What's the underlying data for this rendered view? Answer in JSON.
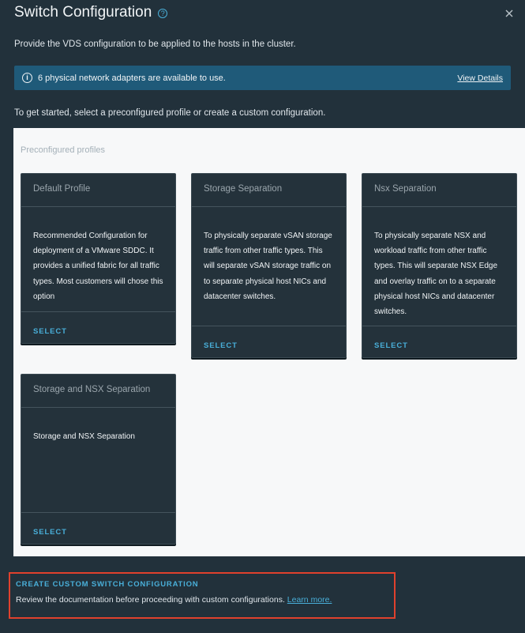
{
  "dialog": {
    "title": "Switch Configuration",
    "help_icon": "help-circle-icon",
    "close_icon": "close-icon",
    "subtitle": "Provide the VDS configuration to be applied to the hosts in the cluster."
  },
  "alert": {
    "icon": "info-circle-icon",
    "message": "6 physical network adapters are available to use.",
    "action_label": "View Details"
  },
  "intro_text": "To get started, select a preconfigured profile or create a custom configuration.",
  "profiles": {
    "section_label": "Preconfigured profiles",
    "cards": [
      {
        "title": "Default Profile",
        "description": "Recommended Configuration for deployment of a VMware SDDC. It provides a unified fabric for all traffic types. Most customers will chose this option",
        "select_label": "SELECT"
      },
      {
        "title": "Storage Separation",
        "description": "To physically separate vSAN storage traffic from other traffic types. This will separate vSAN storage traffic on to separate physical host NICs and datacenter switches.",
        "select_label": "SELECT"
      },
      {
        "title": "Nsx Separation",
        "description": "To physically separate NSX and workload traffic from other traffic types. This will separate NSX Edge and overlay traffic on to a separate physical host NICs and datacenter switches.",
        "select_label": "SELECT"
      },
      {
        "title": "Storage and NSX Separation",
        "description": "Storage and NSX Separation",
        "select_label": "SELECT"
      }
    ]
  },
  "custom": {
    "title": "CREATE CUSTOM SWITCH CONFIGURATION",
    "description": "Review the documentation before proceeding with custom configurations.",
    "link_label": "Learn more."
  },
  "colors": {
    "background": "#22313b",
    "accent": "#49afd9",
    "alert_bg": "#1f5a79",
    "card_bg": "#24323b",
    "panel_bg": "#f7f8f9",
    "highlight_border": "#e0412d"
  }
}
